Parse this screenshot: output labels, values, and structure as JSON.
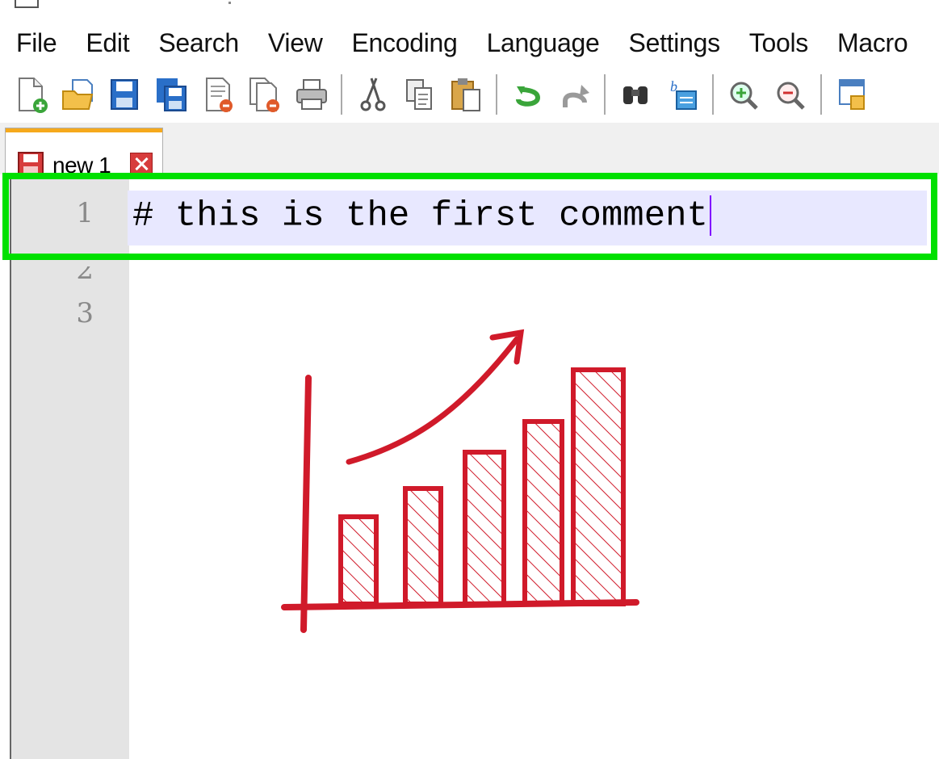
{
  "menu": [
    "File",
    "Edit",
    "Search",
    "View",
    "Encoding",
    "Language",
    "Settings",
    "Tools",
    "Macro"
  ],
  "toolbar": {
    "buttons": [
      "new-file-icon",
      "open-file-icon",
      "save-icon",
      "save-all-icon",
      "close-icon",
      "close-all-icon",
      "print-icon",
      "cut-icon",
      "copy-icon",
      "paste-icon",
      "undo-icon",
      "redo-icon",
      "find-icon",
      "replace-icon",
      "zoom-in-icon",
      "zoom-out-icon",
      "sync-icon"
    ]
  },
  "tab": {
    "label": "new 1"
  },
  "editor": {
    "line_numbers": [
      "1",
      "2",
      "3"
    ],
    "line1": "# this is the first comment"
  },
  "colors": {
    "highlight": "#00e000",
    "current_line": "#e8e8ff",
    "sketch": "#d01a2a",
    "tab_accent": "#f6a91c"
  },
  "illustration": {
    "icon": "hand-drawn-bar-chart-icon",
    "bars": 5,
    "trend": "up"
  }
}
